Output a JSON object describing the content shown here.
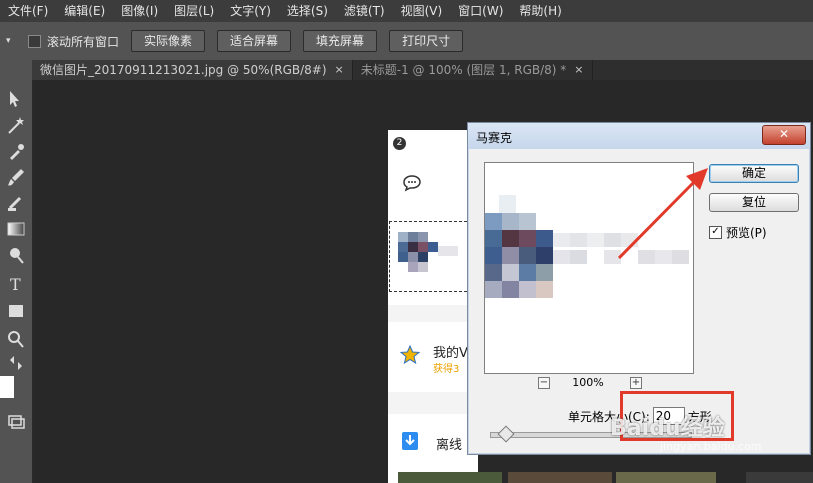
{
  "menubar": {
    "items": [
      "文件(F)",
      "编辑(E)",
      "图像(I)",
      "图层(L)",
      "文字(Y)",
      "选择(S)",
      "滤镜(T)",
      "视图(V)",
      "窗口(W)",
      "帮助(H)"
    ]
  },
  "options": {
    "scroll_all_label": "滚动所有窗口",
    "buttons": [
      "实际像素",
      "适合屏幕",
      "填充屏幕",
      "打印尺寸"
    ]
  },
  "tabs": [
    {
      "label": "微信图片_20170911213021.jpg @ 50%(RGB/8#)",
      "close": "×"
    },
    {
      "label": "未标题-1 @ 100% (图层 1, RGB/8) *",
      "close": "×"
    }
  ],
  "doc": {
    "badge": "2",
    "item1_title": "我的V",
    "item1_sub": "获得3",
    "item2_title": "离线"
  },
  "dialog": {
    "title": "马赛克",
    "close": "✕",
    "ok": "确定",
    "reset": "复位",
    "preview_label": "预览(P)",
    "zoom": "100%",
    "zoom_minus": "−",
    "zoom_plus": "+",
    "cell_label": "单元格大小(C):",
    "cell_value": "20",
    "cell_unit": "方形"
  },
  "watermark": {
    "text": "Baidu经验",
    "sub": "jingyan.baidu.com"
  },
  "colors": {
    "highlight": "#e23a2a",
    "arrow": "#e23a2a"
  }
}
